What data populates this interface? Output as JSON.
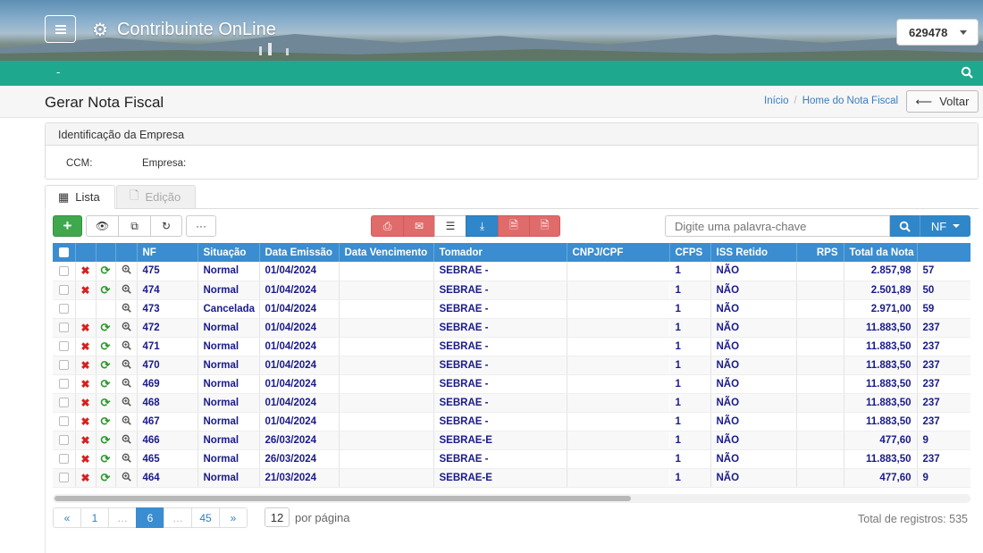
{
  "app": {
    "title": "Contribuinte OnLine",
    "user_id": "629478"
  },
  "navbar": {
    "dash": "-"
  },
  "page": {
    "title": "Gerar Nota Fiscal",
    "back_label": "Voltar"
  },
  "breadcrumb": [
    {
      "label": "Início"
    },
    {
      "label": "Home do Nota Fiscal"
    }
  ],
  "company_panel": {
    "title": "Identificação da Empresa",
    "ccm_label": "CCM:",
    "empresa_label": "Empresa:"
  },
  "tabs": [
    {
      "label": "Lista",
      "active": true
    },
    {
      "label": "Edição",
      "active": false
    }
  ],
  "toolbar": {
    "add": "+",
    "more": "···"
  },
  "search": {
    "placeholder": "Digite uma palavra-chave",
    "filter_label": "NF"
  },
  "colors": {
    "header_blue": "#3a8dd0",
    "nav_teal": "#1ea88e",
    "action_red": "#e06b6b",
    "add_green": "#3fa84d"
  },
  "table": {
    "columns": [
      "",
      "",
      "",
      "",
      "NF",
      "Situação",
      "Data Emissão",
      "Data Vencimento",
      "Tomador",
      "CNPJ/CPF",
      "CFPS",
      "ISS Retido",
      "RPS",
      "Total da Nota",
      ""
    ],
    "rows": [
      {
        "actions": true,
        "nf": "475",
        "situacao": "Normal",
        "emissao": "01/04/2024",
        "vencimento": "",
        "tomador": "SEBRAE -",
        "cnpj": "",
        "cfps": "1",
        "iss": "NÃO",
        "rps": "",
        "total": "2.857,98",
        "extra": "57"
      },
      {
        "actions": true,
        "nf": "474",
        "situacao": "Normal",
        "emissao": "01/04/2024",
        "vencimento": "",
        "tomador": "SEBRAE -",
        "cnpj": "",
        "cfps": "1",
        "iss": "NÃO",
        "rps": "",
        "total": "2.501,89",
        "extra": "50"
      },
      {
        "actions": false,
        "nf": "473",
        "situacao": "Cancelada",
        "emissao": "01/04/2024",
        "vencimento": "",
        "tomador": "SEBRAE -",
        "cnpj": "",
        "cfps": "1",
        "iss": "NÃO",
        "rps": "",
        "total": "2.971,00",
        "extra": "59"
      },
      {
        "actions": true,
        "nf": "472",
        "situacao": "Normal",
        "emissao": "01/04/2024",
        "vencimento": "",
        "tomador": "SEBRAE -",
        "cnpj": "",
        "cfps": "1",
        "iss": "NÃO",
        "rps": "",
        "total": "11.883,50",
        "extra": "237"
      },
      {
        "actions": true,
        "nf": "471",
        "situacao": "Normal",
        "emissao": "01/04/2024",
        "vencimento": "",
        "tomador": "SEBRAE -",
        "cnpj": "",
        "cfps": "1",
        "iss": "NÃO",
        "rps": "",
        "total": "11.883,50",
        "extra": "237"
      },
      {
        "actions": true,
        "nf": "470",
        "situacao": "Normal",
        "emissao": "01/04/2024",
        "vencimento": "",
        "tomador": "SEBRAE -",
        "cnpj": "",
        "cfps": "1",
        "iss": "NÃO",
        "rps": "",
        "total": "11.883,50",
        "extra": "237"
      },
      {
        "actions": true,
        "nf": "469",
        "situacao": "Normal",
        "emissao": "01/04/2024",
        "vencimento": "",
        "tomador": "SEBRAE -",
        "cnpj": "",
        "cfps": "1",
        "iss": "NÃO",
        "rps": "",
        "total": "11.883,50",
        "extra": "237"
      },
      {
        "actions": true,
        "nf": "468",
        "situacao": "Normal",
        "emissao": "01/04/2024",
        "vencimento": "",
        "tomador": "SEBRAE -",
        "cnpj": "",
        "cfps": "1",
        "iss": "NÃO",
        "rps": "",
        "total": "11.883,50",
        "extra": "237"
      },
      {
        "actions": true,
        "nf": "467",
        "situacao": "Normal",
        "emissao": "01/04/2024",
        "vencimento": "",
        "tomador": "SEBRAE -",
        "cnpj": "",
        "cfps": "1",
        "iss": "NÃO",
        "rps": "",
        "total": "11.883,50",
        "extra": "237"
      },
      {
        "actions": true,
        "nf": "466",
        "situacao": "Normal",
        "emissao": "26/03/2024",
        "vencimento": "",
        "tomador": "SEBRAE-E",
        "cnpj": "",
        "cfps": "1",
        "iss": "NÃO",
        "rps": "",
        "total": "477,60",
        "extra": "9"
      },
      {
        "actions": true,
        "nf": "465",
        "situacao": "Normal",
        "emissao": "26/03/2024",
        "vencimento": "",
        "tomador": "SEBRAE -",
        "cnpj": "",
        "cfps": "1",
        "iss": "NÃO",
        "rps": "",
        "total": "11.883,50",
        "extra": "237"
      },
      {
        "actions": true,
        "nf": "464",
        "situacao": "Normal",
        "emissao": "21/03/2024",
        "vencimento": "",
        "tomador": "SEBRAE-E",
        "cnpj": "",
        "cfps": "1",
        "iss": "NÃO",
        "rps": "",
        "total": "477,60",
        "extra": "9"
      }
    ]
  },
  "pagination": {
    "prev": "«",
    "next": "»",
    "pages": [
      {
        "label": "1"
      },
      {
        "label": "…"
      },
      {
        "label": "6",
        "active": true
      },
      {
        "label": "…"
      },
      {
        "label": "45"
      }
    ],
    "per_page": "12",
    "per_page_label": "por página",
    "total_label": "Total de registros: 535"
  }
}
